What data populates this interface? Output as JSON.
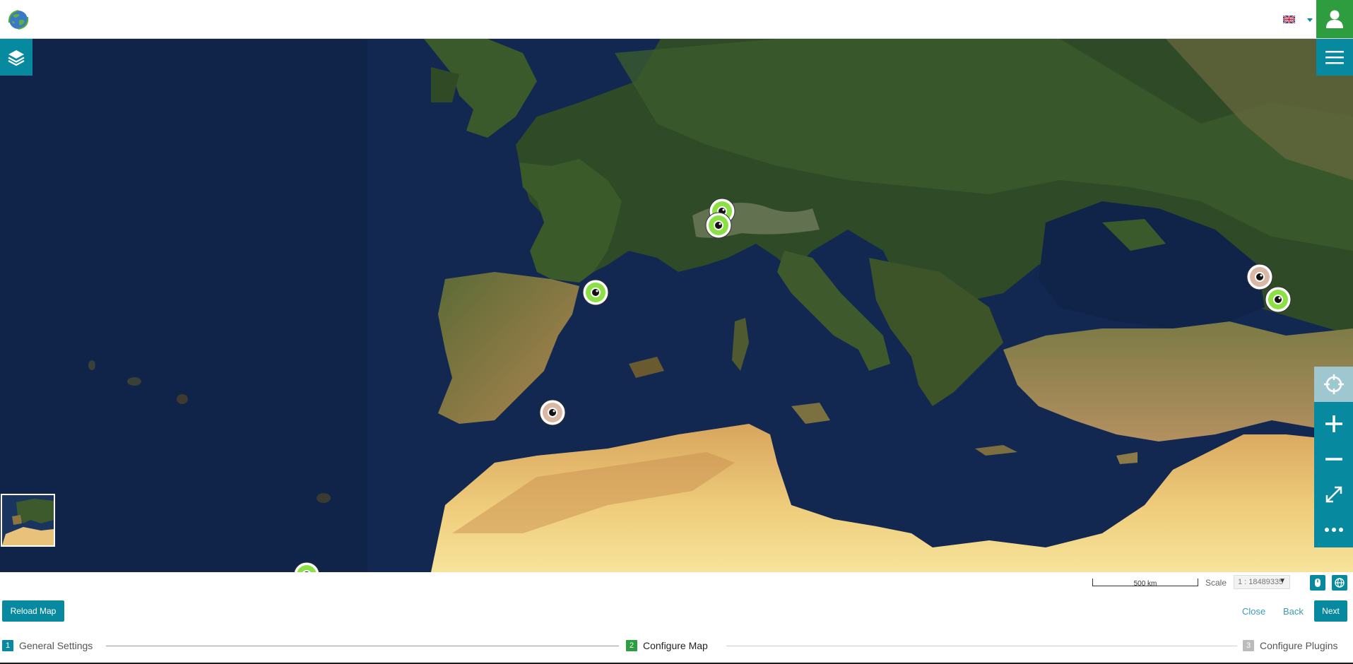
{
  "header": {
    "logo_icon": "globe-logo-icon",
    "language_flag_icon": "uk-flag-icon",
    "user_icon": "user-icon",
    "user_button_color": "#2e9d3f"
  },
  "map": {
    "controls": {
      "layers_icon": "layers-icon",
      "menu_icon": "hamburger-menu-icon",
      "locate_icon": "crosshair-icon",
      "zoom_in_icon": "plus-icon",
      "zoom_out_icon": "minus-icon",
      "fullscreen_icon": "expand-icon",
      "more_icon": "ellipsis-icon"
    },
    "marker_colors": {
      "active": "#8be043",
      "inactive": "#d9b8a6"
    },
    "markers": [
      {
        "id": "alps-north",
        "status": "active"
      },
      {
        "id": "alps-south",
        "status": "active"
      },
      {
        "id": "pyrenees",
        "status": "active"
      },
      {
        "id": "andalusia",
        "status": "inactive"
      },
      {
        "id": "black-sea-west",
        "status": "inactive"
      },
      {
        "id": "black-sea-east",
        "status": "active"
      },
      {
        "id": "atlantic-south",
        "status": "active"
      }
    ]
  },
  "scale": {
    "scalebar_label": "500 km",
    "label": "Scale",
    "value": "1 : 18489335"
  },
  "actions": {
    "reload": "Reload Map",
    "close": "Close",
    "back": "Back",
    "next": "Next"
  },
  "steps": [
    {
      "number": "1",
      "label": "General Settings",
      "state": "done"
    },
    {
      "number": "2",
      "label": "Configure Map",
      "state": "current"
    },
    {
      "number": "3",
      "label": "Configure Plugins",
      "state": "todo"
    }
  ],
  "colors": {
    "accent": "#078aa0",
    "current_step": "#2e9d3f",
    "pending_step": "#bbbbbb"
  }
}
